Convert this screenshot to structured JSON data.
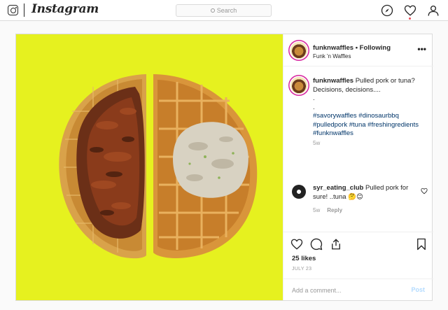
{
  "nav": {
    "brand": "Instagram",
    "search_placeholder": "Search"
  },
  "post": {
    "username": "funknwaffles",
    "follow_separator": "•",
    "follow_status": "Following",
    "location": "Funk 'n Waffles",
    "more_label": "•••",
    "caption": {
      "username": "funknwaffles",
      "text": "Pulled pork or tuna? Decisions, decisions....",
      "dot1": ".",
      "dot2": ".",
      "hashtags": "#savorywaffles #dinosaurbbq #pulledpork #tuna #freshingredients #funknwaffles",
      "time": "5w"
    },
    "comments": [
      {
        "username": "syr_eating_club",
        "text": "Pulled pork for sure! ..tuna 🤔😊",
        "time": "5w",
        "reply_label": "Reply"
      }
    ],
    "likes": "25 likes",
    "date": "JULY 23",
    "add_comment_placeholder": "Add a comment...",
    "post_button": "Post"
  },
  "colors": {
    "photo_background": "#e6f11f",
    "link": "#003569",
    "post_button": "#b3dbff",
    "notification": "#ed4956"
  },
  "icons": [
    "instagram-glyph-icon",
    "search-icon",
    "compass-icon",
    "heart-icon",
    "profile-icon",
    "more-icon",
    "like-icon",
    "comment-icon",
    "share-icon",
    "bookmark-icon"
  ]
}
